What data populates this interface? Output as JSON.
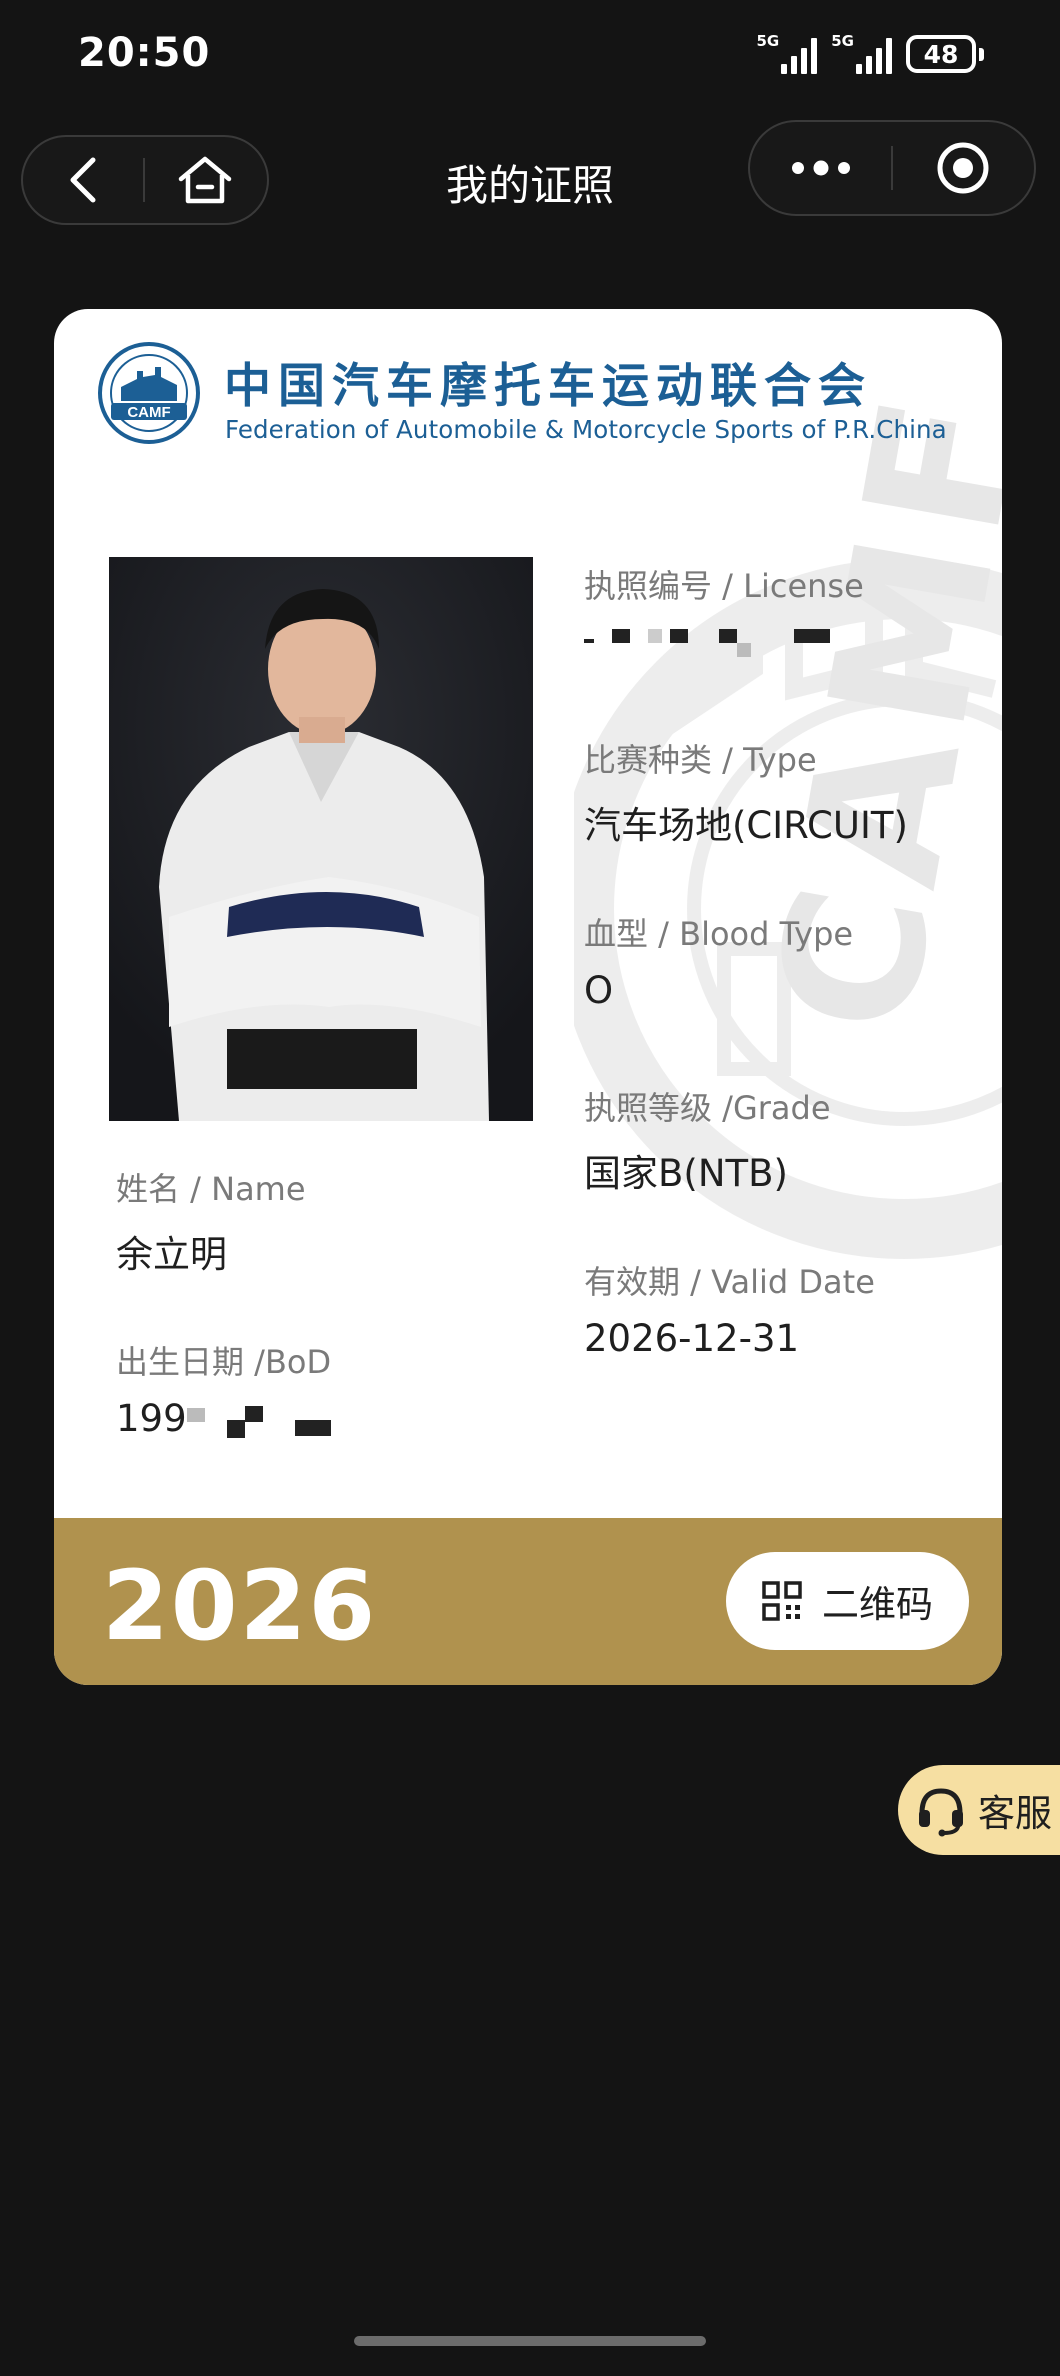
{
  "status_bar": {
    "time": "20:50",
    "signal1_label": "5G",
    "signal2_label": "5G",
    "battery": "48"
  },
  "nav": {
    "title": "我的证照",
    "back_icon": "chevron-left-icon",
    "home_icon": "home-icon",
    "more_icon": "more-dots-icon",
    "close_icon": "target-circle-icon"
  },
  "card": {
    "org_name_cn": "中国汽车摩托车运动联合会",
    "org_name_en": "Federation of Automobile & Motorcycle Sports of P.R.China",
    "logo_text": "CAMF",
    "watermark_text": "CAMF",
    "name": {
      "label": "姓名 / Name",
      "value": "余立明"
    },
    "birth_date": {
      "label": "出生日期 /BoD",
      "value_visible": "199"
    },
    "license": {
      "label": "执照编号 / License"
    },
    "type": {
      "label": "比赛种类 / Type",
      "value": "汽车场地(CIRCUIT)"
    },
    "blood_type": {
      "label": "血型 / Blood Type",
      "value": "O"
    },
    "grade": {
      "label": "执照等级 /Grade",
      "value": "国家B(NTB)"
    },
    "valid_date": {
      "label": "有效期 / Valid Date",
      "value": "2026-12-31"
    },
    "footer": {
      "year": "2026",
      "qr_label": "二维码",
      "qr_icon": "qr-code-icon"
    },
    "colors": {
      "brand_blue": "#1c5f95",
      "footer_gold": "#b0924e"
    }
  },
  "service_button": {
    "label": "客服",
    "icon": "headset-icon",
    "color": "#f6dfa2"
  }
}
